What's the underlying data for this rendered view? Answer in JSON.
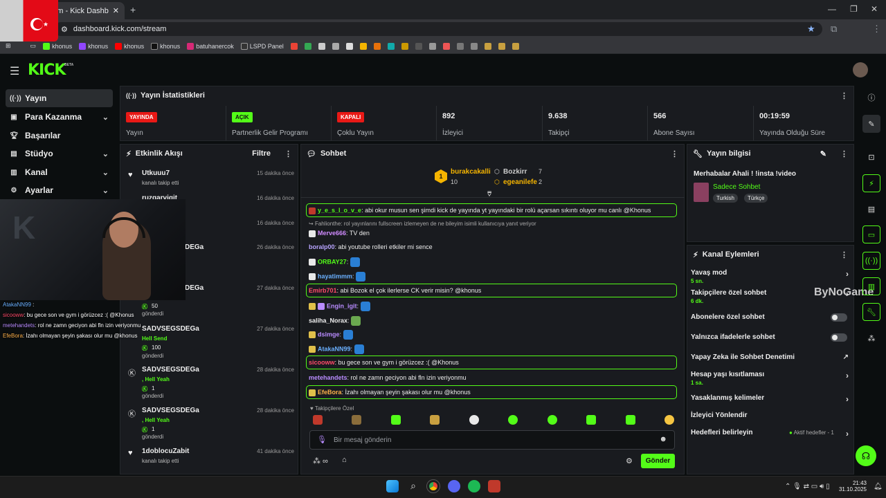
{
  "browser": {
    "tab_title": "Stream - Kick Dashboard",
    "url": "dashboard.kick.com/stream",
    "bookmarks": [
      "khonus",
      "khonus",
      "khonus",
      "khonus",
      "batuhanercok",
      "LSPD Panel"
    ]
  },
  "sidebar": {
    "items": [
      {
        "label": "Yayın",
        "icon": "broadcast-icon"
      },
      {
        "label": "Para Kazanma",
        "icon": "money-icon"
      },
      {
        "label": "Başarılar",
        "icon": "trophy-icon"
      },
      {
        "label": "Stüdyo",
        "icon": "studio-icon"
      },
      {
        "label": "Kanal",
        "icon": "channel-icon"
      },
      {
        "label": "Ayarlar",
        "icon": "gear-icon"
      }
    ]
  },
  "stats": {
    "title": "Yayın İstatistikleri",
    "cells": [
      {
        "pill": "YAYINDA",
        "pill_color": "#e91916",
        "label": "Yayın"
      },
      {
        "pill": "AÇIK",
        "pill_color": "#53fc18",
        "label": "Partnerlik Gelir Programı"
      },
      {
        "pill": "KAPALI",
        "pill_color": "#e91916",
        "label": "Çoklu Yayın"
      },
      {
        "value": "892",
        "label": "İzleyici"
      },
      {
        "value": "9.638",
        "label": "Takipçi"
      },
      {
        "value": "566",
        "label": "Abone Sayısı"
      },
      {
        "value": "00:19:59",
        "label": "Yayında Olduğu Süre"
      }
    ]
  },
  "activity": {
    "title": "Etkinlik Akışı",
    "filter": "Filtre",
    "items": [
      {
        "name": "Utkuuu7",
        "sub": "kanalı takip etti",
        "time": "15 dakika önce"
      },
      {
        "name": "ruzgarvigit",
        "sub": "",
        "time": "16 dakika önce"
      },
      {
        "name": "",
        "sub": "",
        "time": "16 dakika önce"
      },
      {
        "name": "DEGa",
        "sub": "",
        "time": "26 dakika önce"
      },
      {
        "name": "DEGa",
        "sub": "50",
        "sub2": "gönderdi",
        "time": "27 dakika önce"
      },
      {
        "name": "SADVSEGSDEGa",
        "sub": "Hell Send",
        "sub2": "100",
        "sub3": "gönderdi",
        "time": "27 dakika önce"
      },
      {
        "name": "SADVSEGSDEGa",
        "sub": ", Hell Yeah",
        "sub2": "1",
        "sub3": "gönderdi",
        "time": "28 dakika önce"
      },
      {
        "name": "SADVSEGSDEGa",
        "sub": ", Hell Yeah",
        "sub2": "1",
        "sub3": "gönderdi",
        "time": "28 dakika önce"
      },
      {
        "name": "1doblocuZabit",
        "sub": "kanalı takip etti",
        "time": "41 dakika önce"
      }
    ]
  },
  "chat": {
    "title": "Sohbet",
    "top": [
      {
        "rank": "1",
        "name": "burakcakalli",
        "count": "10"
      },
      {
        "name": "Bozkirr",
        "count": "7"
      },
      {
        "name": "egeanilefe",
        "count": "2"
      }
    ],
    "messages": [
      {
        "user": "y_e_s_l_o_v_e",
        "text": ": abi okur musun sen şimdi kick de yayında yt yayındaki bir rolü açarsan sıkıntı oluyor mu canlı @Khonus"
      },
      {
        "user": "Fahlionthe",
        "text": ": rol yayınlarını fullscreen izlemeyen de ne bileyim isimli kullanıcıya yanıt veriyor"
      },
      {
        "user": "Merve666",
        "text": ": TV den"
      },
      {
        "user": "boralp00",
        "text": ": abi youtube rolleri etkiler mi sence"
      },
      {
        "user": "ORBAY27",
        "text": ":"
      },
      {
        "user": "hayatimmm",
        "text": ":"
      },
      {
        "user": "Emirb701",
        "text": ": abi Bozok el çok ilerlerse CK verir misin? @khonus"
      },
      {
        "user": "Engin_igit",
        "text": ":"
      },
      {
        "user": "saliha_Norax",
        "text": ":"
      },
      {
        "user": "dsimge",
        "text": ":"
      },
      {
        "user": "AtakaNN99",
        "text": ":"
      },
      {
        "user": "sicooww",
        "text": ": bu gece son ve gym i görüzcez :( @Khonus"
      },
      {
        "user": "metehandets",
        "text": ": rol ne zamn geciyon abi fln izin veriyonmu"
      },
      {
        "user": "EfeBora",
        "text": ": İzahı olmayan şeyin şakası olur mu @khonus"
      }
    ],
    "followers_only": "Takipçilere Özel",
    "input_placeholder": "Bir mesaj gönderin",
    "send": "Gönder"
  },
  "stream_info": {
    "title": "Yayın bilgisi",
    "stream_title": "Merhabalar Ahali ! !insta !video",
    "category": "Sadece Sohbet",
    "tags": [
      "Turkish",
      "Türkçe"
    ]
  },
  "channel_actions": {
    "title": "Kanal Eylemleri",
    "rows": [
      {
        "label": "Yavaş mod",
        "sub": "5 sn."
      },
      {
        "label": "Takipçilere özel sohbet",
        "sub": "6 dk."
      },
      {
        "label": "Abonelere özel sohbet"
      },
      {
        "label": "Yalnızca ifadelerle sohbet"
      },
      {
        "label": "Yapay Zeka ile Sohbet Denetimi"
      },
      {
        "label": "Hesap yaşı kısıtlaması",
        "sub": "1 sa."
      },
      {
        "label": "Yasaklanmış kelimeler"
      },
      {
        "label": "İzleyici Yönlendir"
      },
      {
        "label": "Hedefleri belirleyin",
        "extra": "Aktif hedefler - 1"
      }
    ]
  },
  "overlay": {
    "lines": [
      {
        "user": "AtakaNN99",
        "text": " :"
      },
      {
        "user": "sicooww",
        "text": ": bu gece son ve gym i görüzcez :( @Khonus"
      },
      {
        "user": "metehandets",
        "text": ": rol ne zamn geciyon abi fln izin veriyonmu"
      },
      {
        "user": "EfeBora",
        "text": ": İzahı olmayan şeyin şakası olur mu @khonus"
      }
    ],
    "watermark": "ByNoGame"
  },
  "taskbar": {
    "time": "21:43",
    "date": "31.10.2025"
  },
  "colors": {
    "accent": "#53fc18",
    "live": "#e91916"
  }
}
